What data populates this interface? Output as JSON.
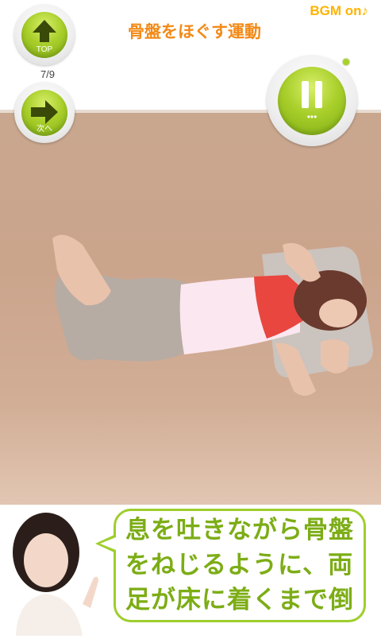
{
  "header": {
    "title": "骨盤をほぐす運動",
    "bgm_label": "BGM on♪",
    "progress": "7/9"
  },
  "buttons": {
    "top_label": "TOP",
    "next_label": "次へ",
    "pause_dots": "•••"
  },
  "instruction": {
    "line1": "息を吐きながら骨盤",
    "line2": "をねじるように、両",
    "line3": "足が床に着くまで倒"
  },
  "colors": {
    "accent_green": "#a9cf2b",
    "title_orange": "#f28a17",
    "bgm_yellow": "#ffb300",
    "floor": "#cba48c"
  },
  "icons": [
    "up-arrow-icon",
    "right-arrow-icon",
    "pause-icon"
  ]
}
